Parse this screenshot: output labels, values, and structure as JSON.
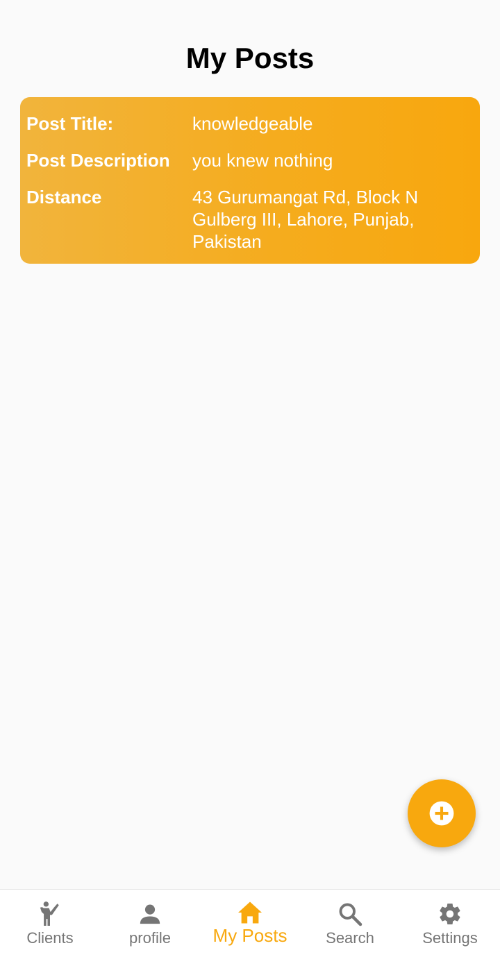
{
  "header": {
    "title": "My Posts"
  },
  "post": {
    "title_label": "Post Title:",
    "title_value": "knowledgeable",
    "description_label": "Post Description",
    "description_value": "you knew nothing",
    "distance_label": "Distance",
    "distance_value": "43 Gurumangat Rd, Block N Gulberg III, Lahore, Punjab, Pakistan"
  },
  "fab": {
    "icon": "add-circle-icon"
  },
  "nav": {
    "items": [
      {
        "label": "Clients",
        "icon": "person-waving-icon"
      },
      {
        "label": "profile",
        "icon": "person-icon"
      },
      {
        "label": "My Posts",
        "icon": "home-icon",
        "active": true
      },
      {
        "label": "Search",
        "icon": "search-icon"
      },
      {
        "label": "Settings",
        "icon": "gear-icon"
      }
    ]
  },
  "colors": {
    "accent": "#f8a80e",
    "inactive": "#757575",
    "background": "#fafafa"
  }
}
